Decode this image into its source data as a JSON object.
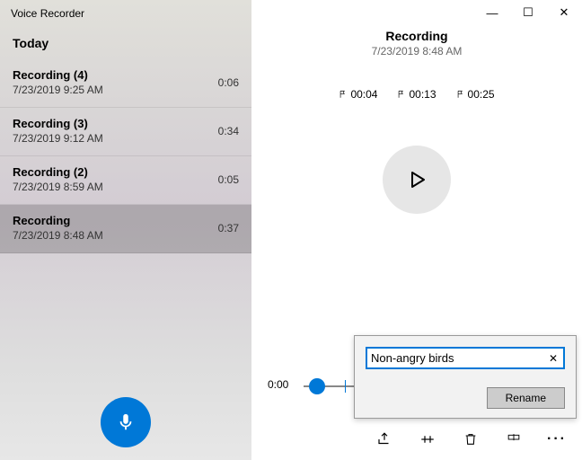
{
  "app_title": "Voice Recorder",
  "section_header": "Today",
  "recordings": [
    {
      "title": "Recording (4)",
      "datetime": "7/23/2019 9:25 AM",
      "duration": "0:06",
      "selected": false
    },
    {
      "title": "Recording (3)",
      "datetime": "7/23/2019 9:12 AM",
      "duration": "0:34",
      "selected": false
    },
    {
      "title": "Recording (2)",
      "datetime": "7/23/2019 8:59 AM",
      "duration": "0:05",
      "selected": false
    },
    {
      "title": "Recording",
      "datetime": "7/23/2019 8:48 AM",
      "duration": "0:37",
      "selected": true
    }
  ],
  "detail": {
    "title": "Recording",
    "datetime": "7/23/2019 8:48 AM",
    "markers": [
      "00:04",
      "00:13",
      "00:25"
    ],
    "current_time": "0:00"
  },
  "rename_popup": {
    "value": "Non-angry birds",
    "button_label": "Rename"
  },
  "window_controls": {
    "minimize": "—",
    "maximize": "☐",
    "close": "✕"
  }
}
